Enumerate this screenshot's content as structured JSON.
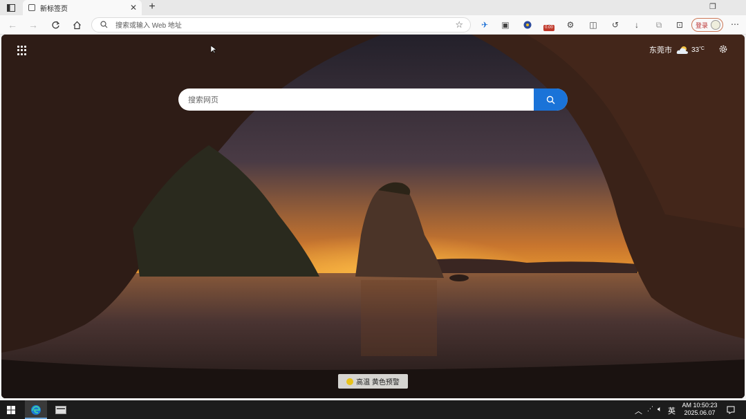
{
  "browser": {
    "tab": {
      "title": "新标签页"
    },
    "address_bar": {
      "placeholder": "搜索或输入 Web 地址"
    },
    "extension_badge": "0.00",
    "profile_label": "登录"
  },
  "newtab": {
    "search_placeholder": "搜索网页",
    "weather": {
      "city": "东莞市",
      "temperature": "33",
      "unit": "°C"
    },
    "alert": {
      "text": "高温 黄色预警"
    }
  },
  "taskbar": {
    "ime": "英",
    "time": "AM 10:50:23",
    "date": "2025.06.07"
  },
  "colors": {
    "accent": "#1a73d8",
    "taskbar": "#1c1c1c",
    "alert_icon": "#e8c21a"
  },
  "icons": [
    "sidebar-icon",
    "tab-page-icon",
    "close-icon",
    "plus-icon",
    "back-icon",
    "forward-icon",
    "refresh-icon",
    "home-icon",
    "search-icon",
    "star-icon",
    "apps-grid-icon",
    "cloud-icon",
    "gear-icon",
    "windows-start-icon",
    "edge-icon",
    "notification-icon"
  ]
}
